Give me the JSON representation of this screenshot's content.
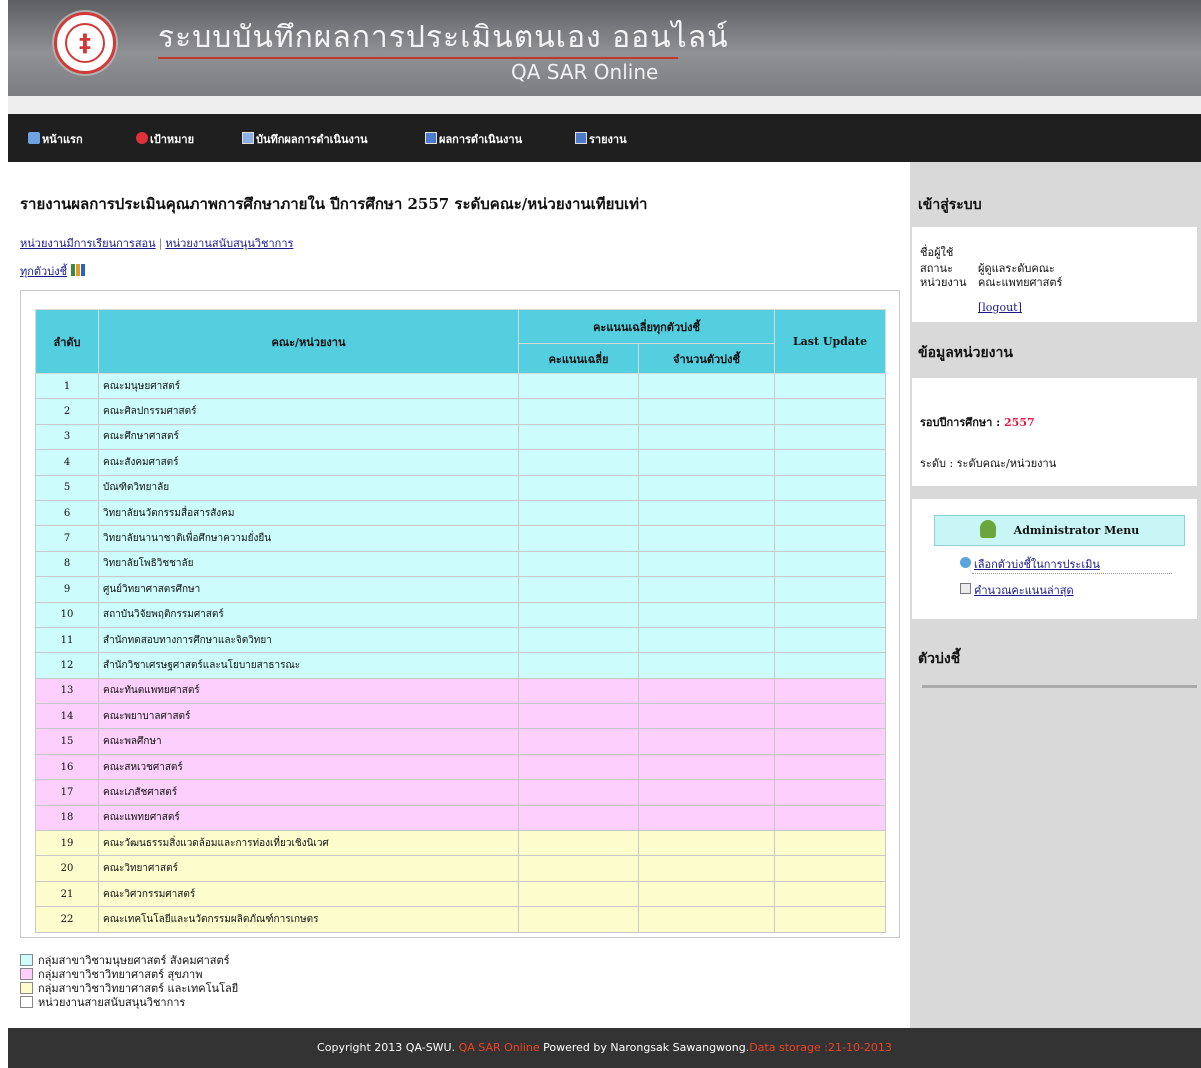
{
  "header": {
    "title": "ระบบบันทึกผลการประเมินตนเอง ออนไลน์",
    "subtitle": "QA SAR Online"
  },
  "nav": [
    {
      "label": "หน้าแรก",
      "icon": "home-icon"
    },
    {
      "label": "เป้าหมาย",
      "icon": "target-icon"
    },
    {
      "label": "บันทึกผลการดำเนินงาน",
      "icon": "edit-icon"
    },
    {
      "label": "ผลการดำเนินงาน",
      "icon": "chart-icon"
    },
    {
      "label": "รายงาน",
      "icon": "report-icon"
    }
  ],
  "main": {
    "page_title": "รายงานผลการประเมินคุณภาพการศึกษาภายใน ปีการศึกษา 2557 ระดับคณะ/หน่วยงานเทียบเท่า",
    "link_teaching": "หน่วยงานมีการเรียนการสอน",
    "link_support": "หน่วยงานสนับสนุนวิชาการ",
    "link_sep": "|",
    "all_indicators": "ทุกตัวบ่งชี้"
  },
  "table": {
    "col_no": "ลำดับ",
    "col_unit": "คณะ/หน่วยงาน",
    "col_group": "คะแนนเฉลี่ยทุกตัวบ่งชี้",
    "col_avg": "คะแนนเฉลี่ย",
    "col_count": "จำนวนตัวบ่งชี้",
    "col_update": "Last Update",
    "rows": [
      {
        "no": "1",
        "name": "คณะมนุษยศาสตร์",
        "group": "g1"
      },
      {
        "no": "2",
        "name": "คณะศิลปกรรมศาสตร์",
        "group": "g1"
      },
      {
        "no": "3",
        "name": "คณะศึกษาศาสตร์",
        "group": "g1"
      },
      {
        "no": "4",
        "name": "คณะสังคมศาสตร์",
        "group": "g1"
      },
      {
        "no": "5",
        "name": "บัณฑิตวิทยาลัย",
        "group": "g1"
      },
      {
        "no": "6",
        "name": "วิทยาลัยนวัตกรรมสื่อสารสังคม",
        "group": "g1"
      },
      {
        "no": "7",
        "name": "วิทยาลัยนานาชาติเพื่อศึกษาความยั่งยืน",
        "group": "g1"
      },
      {
        "no": "8",
        "name": "วิทยาลัยโพธิวิชชาลัย",
        "group": "g1"
      },
      {
        "no": "9",
        "name": "ศูนย์วิทยาศาสตรศึกษา",
        "group": "g1"
      },
      {
        "no": "10",
        "name": "สถาบันวิจัยพฤติกรรมศาสตร์",
        "group": "g1"
      },
      {
        "no": "11",
        "name": "สำนักทดสอบทางการศึกษาและจิตวิทยา",
        "group": "g1"
      },
      {
        "no": "12",
        "name": "สำนักวิชาเศรษฐศาสตร์และนโยบายสาธารณะ",
        "group": "g1"
      },
      {
        "no": "13",
        "name": "คณะทันตแพทยศาสตร์",
        "group": "g2"
      },
      {
        "no": "14",
        "name": "คณะพยาบาลศาสตร์",
        "group": "g2"
      },
      {
        "no": "15",
        "name": "คณะพลศึกษา",
        "group": "g2"
      },
      {
        "no": "16",
        "name": "คณะสหเวชศาสตร์",
        "group": "g2"
      },
      {
        "no": "17",
        "name": "คณะเภสัชศาสตร์",
        "group": "g2"
      },
      {
        "no": "18",
        "name": "คณะแพทยศาสตร์",
        "group": "g2"
      },
      {
        "no": "19",
        "name": "คณะวัฒนธรรมสิ่งแวดล้อมและการท่องเที่ยวเชิงนิเวศ",
        "group": "g3"
      },
      {
        "no": "20",
        "name": "คณะวิทยาศาสตร์",
        "group": "g3"
      },
      {
        "no": "21",
        "name": "คณะวิศวกรรมศาสตร์",
        "group": "g3"
      },
      {
        "no": "22",
        "name": "คณะเทคโนโลยีและนวัตกรรมผลิตภัณฑ์การเกษตร",
        "group": "g3"
      }
    ]
  },
  "legend": [
    {
      "label": "กลุ่มสาขาวิชามนุษยศาสตร์ สังคมศาสตร์",
      "color": "#ccfcfc"
    },
    {
      "label": "กลุ่มสาขาวิชาวิทยาศาสตร์ สุขภาพ",
      "color": "#fccffc"
    },
    {
      "label": "กลุ่มสาขาวิชาวิทยาศาสตร์ และเทคโนโลยี",
      "color": "#fcfccd"
    },
    {
      "label": "หน่วยงานสายสนับสนุนวิชาการ",
      "color": "#ffffff"
    }
  ],
  "sidebar": {
    "login_heading": "เข้าสู่ระบบ",
    "user_label": "ชื่อผู้ใช้",
    "user_value": "",
    "status_label": "สถานะ",
    "status_value": "ผู้ดูแลระดับคณะ",
    "unit_label": "หน่วยงาน",
    "unit_value": "คณะแพทยศาสตร์",
    "logout": "[logout]",
    "info_heading": "ข้อมูลหน่วยงาน",
    "year_label": "รอบปีการศึกษา : ",
    "year_value": "2557",
    "level_text": "ระดับ : ระดับคณะ/หน่วยงาน",
    "admin_title": "Administrator Menu",
    "admin_link1": "เลือกตัวบ่งชี้ในการประเมิน",
    "admin_link2": "คำนวณคะแนนล่าสุด",
    "ind_heading": "ตัวบ่งชี้"
  },
  "footer": {
    "part1": "Copyright 2013 QA-SWU. ",
    "part2": "QA SAR Online",
    "part3": " Powered by Narongsak Sawangwong.",
    "part4": "Data storage :21-10-2013"
  },
  "colors": {
    "group1": "#ccfcfc",
    "group2": "#fccffc",
    "group3": "#fcfccd",
    "table_header": "#53cfdf",
    "footer_accent": "#ee4422",
    "highlight": "#e0204a"
  }
}
